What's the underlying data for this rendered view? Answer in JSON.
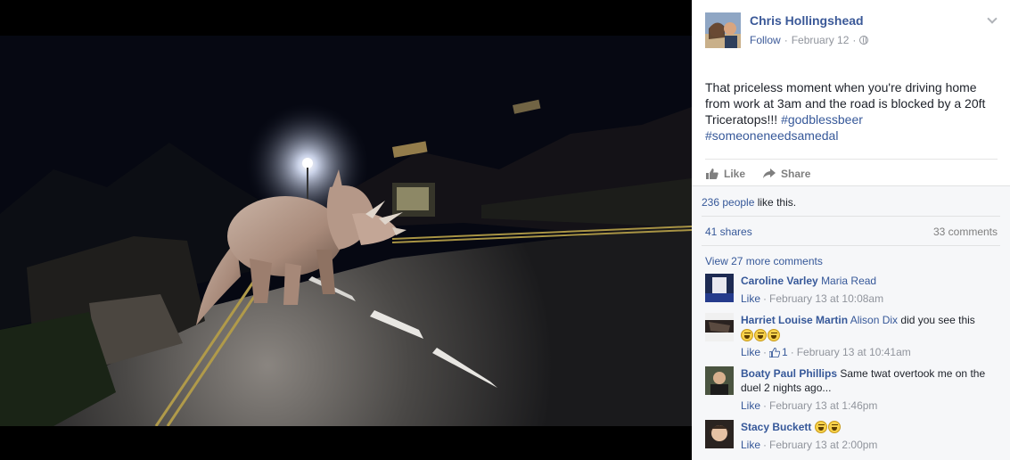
{
  "post": {
    "author": "Chris Hollingshead",
    "follow_label": "Follow",
    "date": "February 12",
    "separator": "·",
    "text_main": "That priceless moment when you're driving home from work at 3am and the road is blocked by a 20ft Triceratops!!! ",
    "hashtags": [
      "#godblessbeer",
      "#someoneneedsamedal"
    ],
    "like_label": "Like",
    "share_label": "Share"
  },
  "ufi": {
    "likes_count": "236 people",
    "likes_suffix": " like this.",
    "shares": "41 shares",
    "comments": "33 comments",
    "view_more": "View 27 more comments"
  },
  "comments": [
    {
      "author": "Caroline Varley",
      "tagged": "Maria Read",
      "text": "",
      "like_label": "Like",
      "time": "February 13 at 10:08am",
      "likes": "",
      "emojis": 0
    },
    {
      "author": "Harriet Louise Martin",
      "tagged": "Alison Dix",
      "text": " did you see this",
      "like_label": "Like",
      "time": "February 13 at 10:41am",
      "likes": "1",
      "emojis": 3
    },
    {
      "author": "Boaty Paul Phillips",
      "tagged": "",
      "text": "Same twat overtook me on the duel 2 nights ago...",
      "like_label": "Like",
      "time": "February 13 at 1:46pm",
      "likes": "",
      "emojis": 0
    },
    {
      "author": "Stacy Buckett",
      "tagged": "",
      "text": "",
      "like_label": "Like",
      "time": "February 13 at 2:00pm",
      "likes": "",
      "emojis": 2
    }
  ],
  "icons": {
    "like": "thumbs-up-icon",
    "share": "share-arrow-icon",
    "privacy": "globe-icon",
    "options": "chevron-down-icon"
  },
  "colors": {
    "link": "#365899",
    "author": "#3b5998",
    "meta": "#90949c",
    "ufi_bg": "#f6f7f9"
  }
}
